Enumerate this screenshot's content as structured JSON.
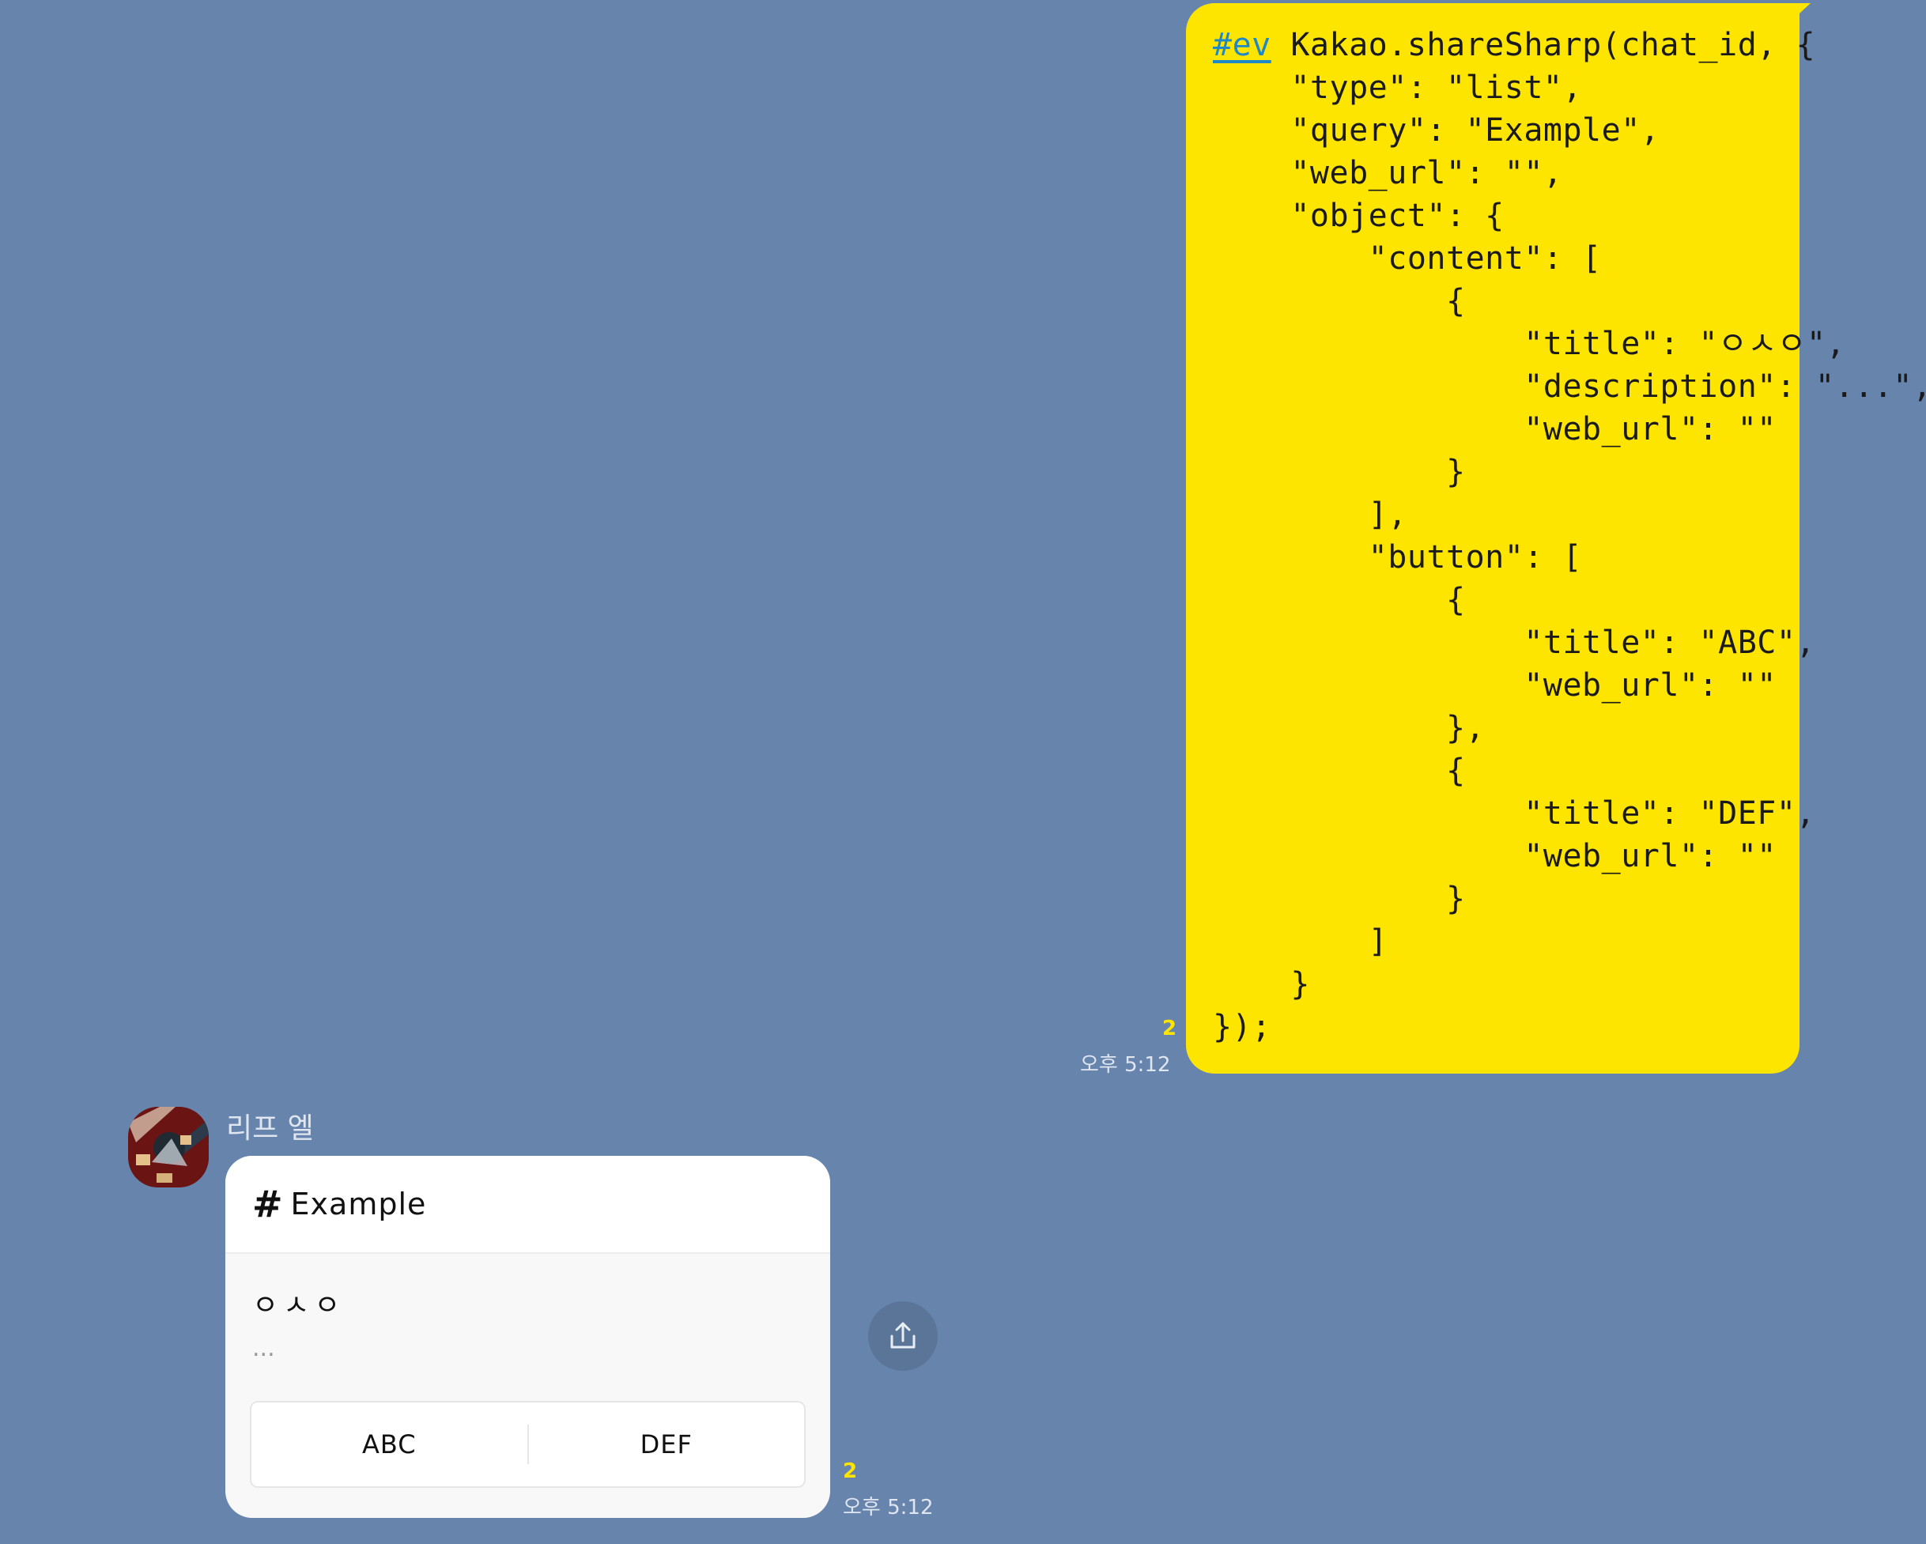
{
  "sent_message": {
    "hashtag": "#ev",
    "first_line_rest": " Kakao.shareSharp(chat_id, {",
    "code_rest": "    \"type\": \"list\",\n    \"query\": \"Example\",\n    \"web_url\": \"\",\n    \"object\": {\n        \"content\": [\n            {\n                \"title\": \"ㅇㅅㅇ\",\n                \"description\": \"...\",\n                \"web_url\": \"\"\n            }\n        ],\n        \"button\": [\n            {\n                \"title\": \"ABC\",\n                \"web_url\": \"\"\n            },\n            {\n                \"title\": \"DEF\",\n                \"web_url\": \"\"\n            }\n        ]\n    }\n});",
    "read_count": "2",
    "time": "오후 5:12"
  },
  "received_message": {
    "sender_name": "리프 엘",
    "card": {
      "hash_symbol": "#",
      "query_title": "Example",
      "item_title": "ㅇㅅㅇ",
      "item_description": "...",
      "buttons": [
        "ABC",
        "DEF"
      ]
    },
    "read_count": "2",
    "time": "오후 5:12"
  },
  "icons": {
    "share": "share-icon",
    "avatar": "avatar-image"
  },
  "colors": {
    "background": "#6784ad",
    "sent_bubble": "#fee500",
    "hashtag": "#1e88c8",
    "read_count": "#fee500",
    "card_bg": "#f8f8f8"
  }
}
